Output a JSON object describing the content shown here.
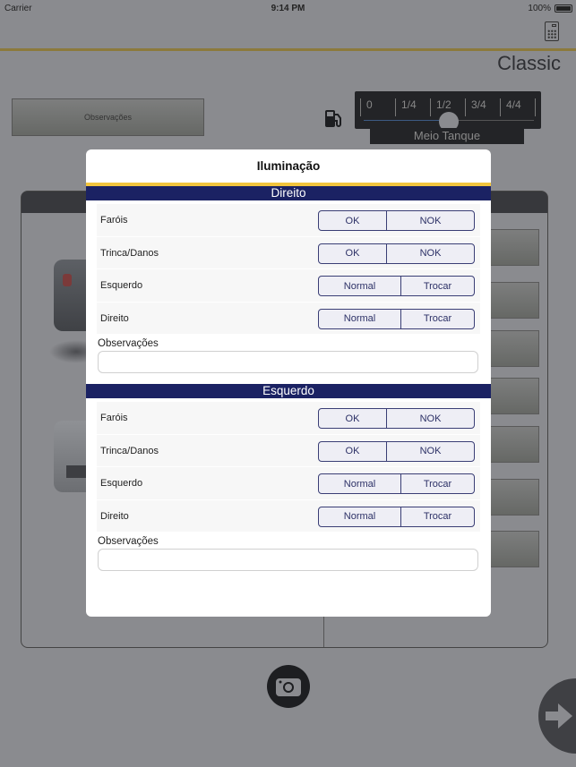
{
  "status_bar": {
    "carrier": "Carrier",
    "time": "9:14 PM",
    "battery": "100%"
  },
  "header": {
    "title": "Classic",
    "calculator_icon": "calculator-icon"
  },
  "toolbar": {
    "observacoes_button": "Observações"
  },
  "fuel": {
    "icon": "fuel-pump-icon",
    "marks": [
      "0",
      "1/4",
      "1/2",
      "3/4",
      "4/4"
    ],
    "level_fraction": 0.5,
    "label": "Meio Tanque"
  },
  "colors": {
    "section_header": "#1b2263",
    "accent_gold": "#f2c53d",
    "segment_border": "#3a3e75"
  },
  "modal": {
    "title": "Iluminação",
    "sections": [
      {
        "title": "Direito",
        "rows": [
          {
            "label": "Faróis",
            "options": [
              "OK",
              "NOK"
            ]
          },
          {
            "label": "Trinca/Danos",
            "options": [
              "OK",
              "NOK"
            ]
          },
          {
            "label": "Esquerdo",
            "options": [
              "Normal",
              "Trocar"
            ]
          },
          {
            "label": "Direito",
            "options": [
              "Normal",
              "Trocar"
            ]
          }
        ],
        "obs_label": "Observações",
        "obs_value": ""
      },
      {
        "title": "Esquerdo",
        "rows": [
          {
            "label": "Faróis",
            "options": [
              "OK",
              "NOK"
            ]
          },
          {
            "label": "Trinca/Danos",
            "options": [
              "OK",
              "NOK"
            ]
          },
          {
            "label": "Esquerdo",
            "options": [
              "Normal",
              "Trocar"
            ]
          },
          {
            "label": "Direito",
            "options": [
              "Normal",
              "Trocar"
            ]
          }
        ],
        "obs_label": "Observações",
        "obs_value": ""
      }
    ]
  },
  "bottom": {
    "camera_icon": "camera-icon",
    "next_icon": "arrow-right-icon"
  }
}
